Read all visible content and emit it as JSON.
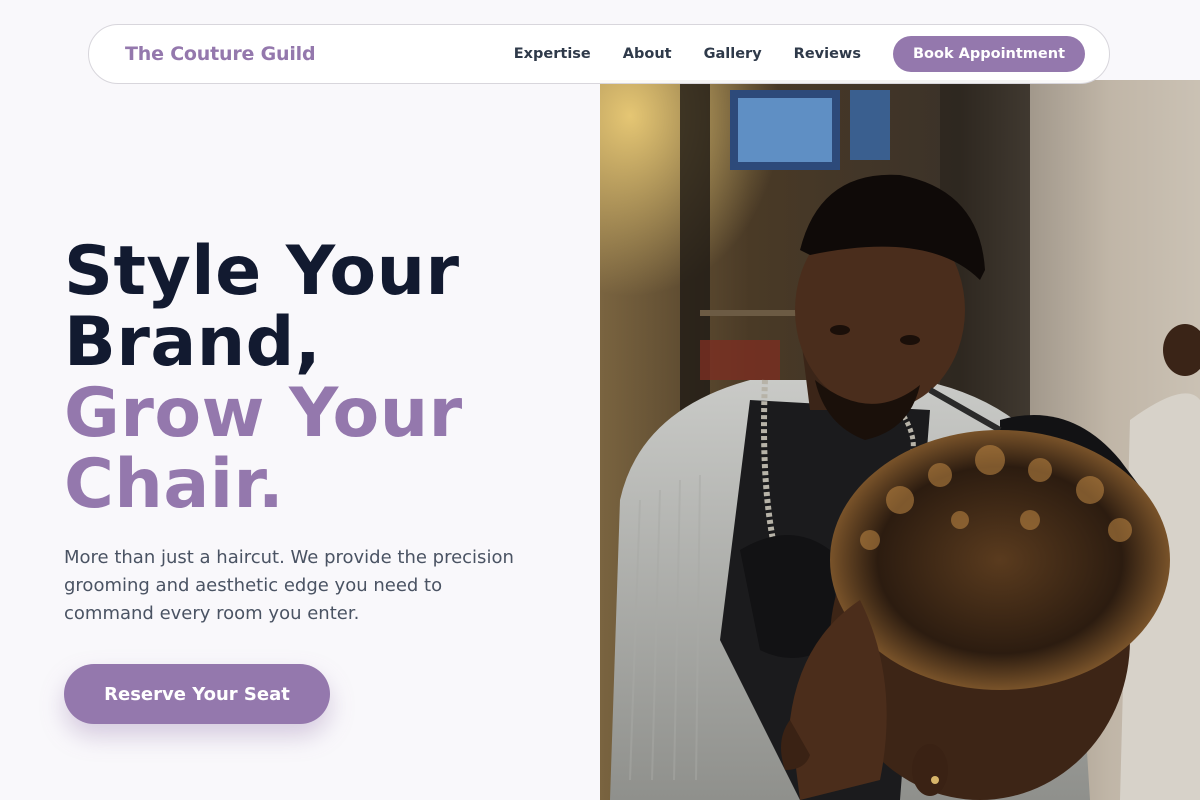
{
  "brand": {
    "name": "The Couture Guild",
    "color": "#9478ad"
  },
  "nav": {
    "links": [
      "Expertise",
      "About",
      "Gallery",
      "Reviews"
    ],
    "cta_label": "Book Appointment"
  },
  "hero": {
    "headline_line1": "Style Your",
    "headline_line2": "Brand,",
    "headline_accent_line1": "Grow Your",
    "headline_accent_line2": "Chair.",
    "subtext": "More than just a haircut. We provide the precision grooming and aesthetic edge you need to command every room you enter.",
    "cta_label": "Reserve Your Seat",
    "image_subject": "barber cutting a client's curly hair in a barbershop"
  },
  "colors": {
    "accent": "#9478ad",
    "headline_dark": "#121a30",
    "body_text": "#4a5363",
    "background": "#f9f8fb"
  }
}
